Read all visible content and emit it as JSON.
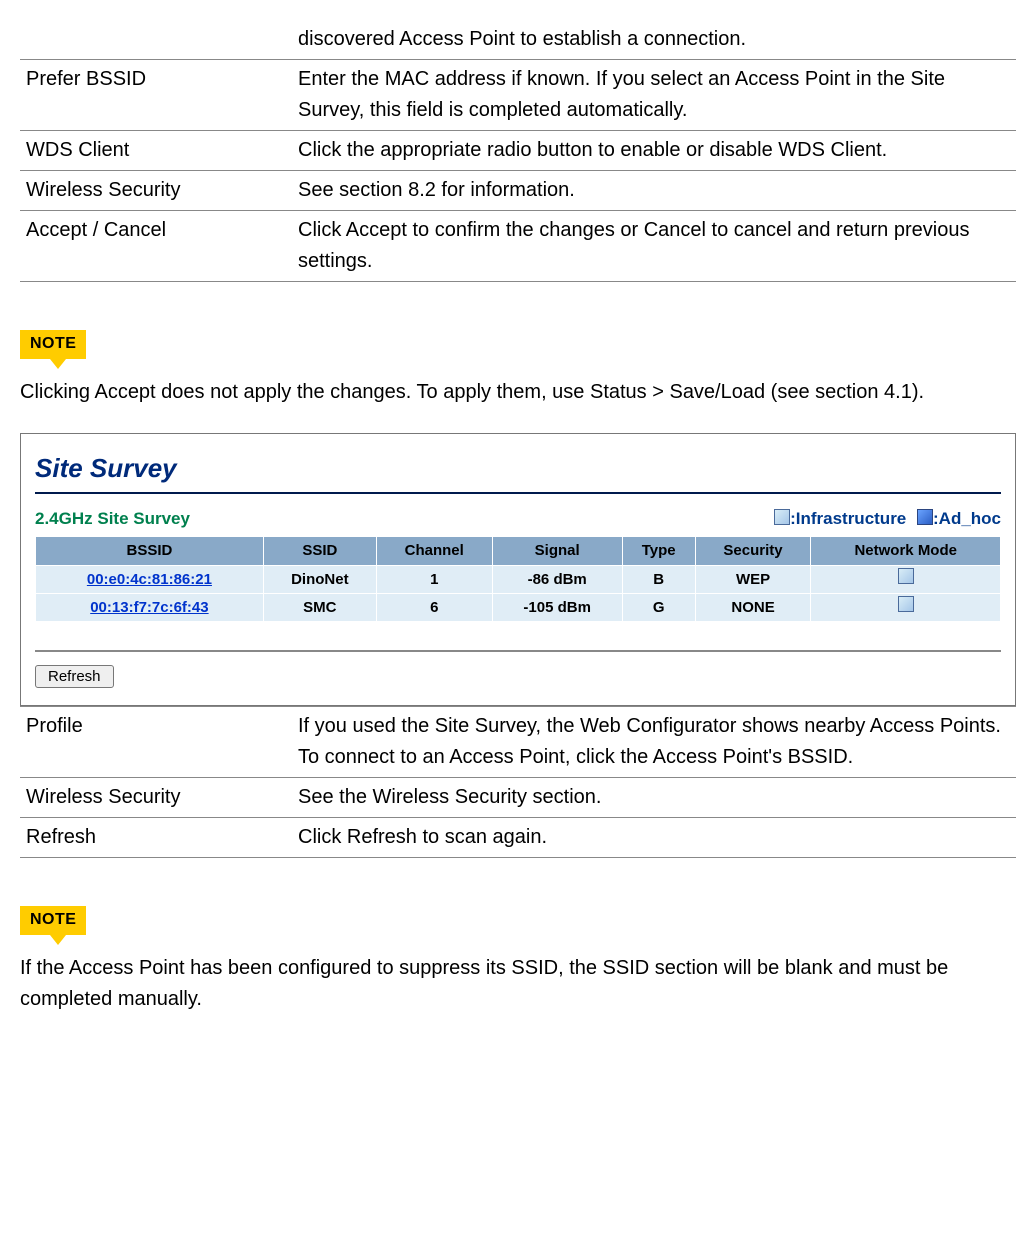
{
  "defs1": [
    {
      "term": "",
      "desc": "discovered Access Point to establish a connection.",
      "first": true
    },
    {
      "term": "Prefer  BSSID",
      "desc": "Enter the MAC address if known. If you select an Access Point in the Site Survey, this field is completed automatically."
    },
    {
      "term": "WDS  Client",
      "desc": "Click the appropriate radio button to enable or disable WDS Client."
    },
    {
      "term": "Wireless  Security",
      "desc": "See section 8.2 for information."
    },
    {
      "term": "Accept  / Cancel",
      "desc": "Click Accept  to confirm the changes or Cancel  to cancel and return previous settings."
    }
  ],
  "note1": {
    "label": "NOTE",
    "text": "Clicking Accept  does not apply the changes. To apply them, use Status  >  Save/Load   (see section 4.1)."
  },
  "survey": {
    "title": "Site Survey",
    "subtitle": "2.4GHz Site Survey",
    "legend_infra": ":Infrastructure",
    "legend_adhoc": ":Ad_hoc",
    "headers": [
      "BSSID",
      "SSID",
      "Channel",
      "Signal",
      "Type",
      "Security",
      "Network Mode"
    ],
    "rows": [
      {
        "bssid": "00:e0:4c:81:86:21",
        "ssid": "DinoNet",
        "channel": "1",
        "signal": "-86 dBm",
        "type": "B",
        "security": "WEP",
        "mode_icon": "infra"
      },
      {
        "bssid": "00:13:f7:7c:6f:43",
        "ssid": "SMC",
        "channel": "6",
        "signal": "-105 dBm",
        "type": "G",
        "security": "NONE",
        "mode_icon": "infra"
      }
    ],
    "refresh_label": "Refresh"
  },
  "defs2": [
    {
      "term": "Profile",
      "desc": "If you used the Site Survey, the Web Configurator shows nearby Access Points. To connect to an Access Point, click the Access Point's BSSID."
    },
    {
      "term": "Wireless  Security",
      "desc": "See the Wireless Security section."
    },
    {
      "term": "Refresh",
      "desc": "Click Refresh  to scan again."
    }
  ],
  "note2": {
    "label": "NOTE",
    "text": "If the Access Point has been configured to suppress its SSID, the SSID  section will be blank and must be completed manually."
  }
}
